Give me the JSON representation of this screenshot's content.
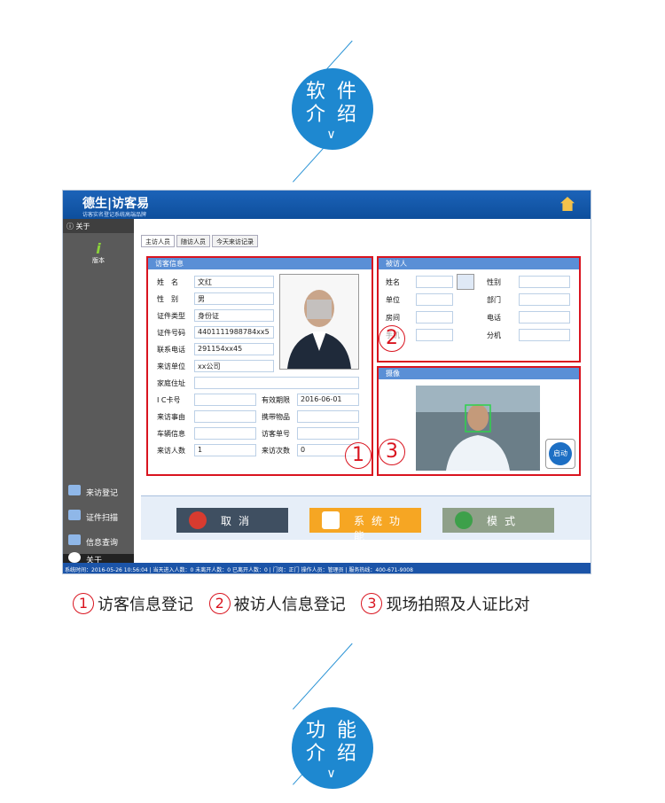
{
  "section1": {
    "line1": "软 件",
    "line2": "介 绍",
    "chevron": "∨"
  },
  "section2": {
    "line1": "功 能",
    "line2": "介 绍",
    "chevron": "∨"
  },
  "app": {
    "logo": "德生|访客易",
    "slogan": "访客实名登记系统高端品牌",
    "sidebar": {
      "header": "关于",
      "version_label": "版本",
      "items": [
        "来访登记",
        "证件扫描",
        "信息查询",
        "关于"
      ]
    },
    "tabs": [
      "主访人员",
      "随访人员",
      "今天来访记录"
    ],
    "visitor_panel": {
      "title": "访客信息",
      "fields": [
        {
          "label": "姓　名",
          "value": "文红"
        },
        {
          "label": "性　别",
          "value": "男"
        },
        {
          "label": "证件类型",
          "value": "身份证"
        },
        {
          "label": "证件号码",
          "value": "4401111988784xx5"
        },
        {
          "label": "联系电话",
          "value": "291154xx45"
        },
        {
          "label": "来访单位",
          "value": "xx公司"
        },
        {
          "label": "家庭住址",
          "value": ""
        },
        {
          "label": "I C卡号",
          "value": ""
        },
        {
          "label": "来访事由",
          "value": ""
        },
        {
          "label": "车辆信息",
          "value": ""
        },
        {
          "label": "来访人数",
          "value": "1"
        }
      ],
      "right_fields": [
        {
          "label": "有效期限",
          "value": "2016-06-01"
        },
        {
          "label": "携带物品",
          "value": ""
        },
        {
          "label": "访客单号",
          "value": ""
        },
        {
          "label": "来访次数",
          "value": "0"
        }
      ]
    },
    "host_panel": {
      "title": "被访人",
      "left_labels": [
        "姓名",
        "单位",
        "房间",
        "手机"
      ],
      "right_labels": [
        "性别",
        "部门",
        "电话",
        "分机"
      ]
    },
    "camera_panel": {
      "title": "摄像",
      "start_button": "启动"
    },
    "buttons": {
      "cancel": "取消",
      "system": "系统功能",
      "mode": "模式"
    },
    "status": "系统时间：2016-05-26 10:56:04 | 当天进入人数：0 未离开人数：0 已离开人数：0 | 门岗：正门 操作人员：管理员 | 服务热线：400-671-9008"
  },
  "markers": [
    "1",
    "2",
    "3"
  ],
  "captions": [
    {
      "num": "1",
      "text": "访客信息登记"
    },
    {
      "num": "2",
      "text": "被访人信息登记"
    },
    {
      "num": "3",
      "text": "现场拍照及人证比对"
    }
  ],
  "colors": {
    "accent": "#1e88d0",
    "highlight": "#d9141f",
    "titlebar": "#1c63b8"
  }
}
